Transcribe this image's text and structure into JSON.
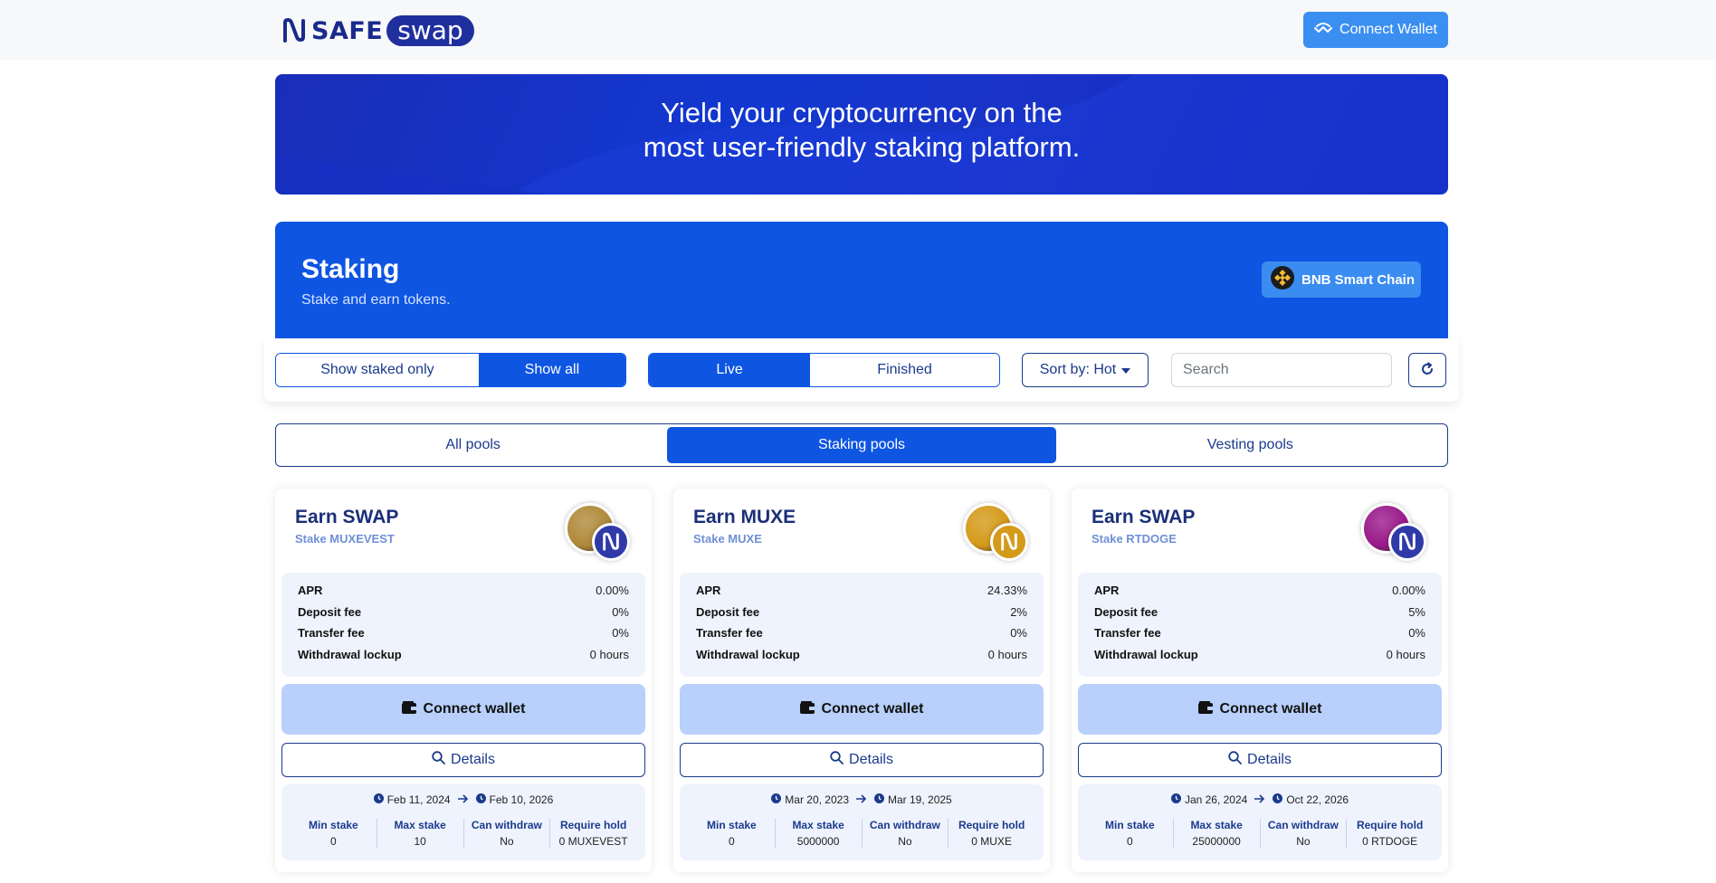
{
  "header": {
    "logo_safe": "SAFE",
    "logo_swap": "swap",
    "connect_label": "Connect Wallet"
  },
  "hero": {
    "line1": "Yield your cryptocurrency on the",
    "line2": "most user-friendly staking platform."
  },
  "staking": {
    "title": "Staking",
    "subtitle": "Stake and earn tokens.",
    "chain_label": "BNB Smart Chain"
  },
  "filters": {
    "staked_only": "Show staked only",
    "show_all": "Show all",
    "live": "Live",
    "finished": "Finished",
    "sort_label": "Sort by: Hot",
    "search_placeholder": "Search"
  },
  "pool_tabs": [
    "All pools",
    "Staking pools",
    "Vesting pools"
  ],
  "labels": {
    "apr": "APR",
    "deposit_fee": "Deposit fee",
    "transfer_fee": "Transfer fee",
    "withdrawal_lockup": "Withdrawal lockup",
    "connect_wallet": "Connect wallet",
    "details": "Details",
    "min_stake": "Min stake",
    "max_stake": "Max stake",
    "can_withdraw": "Can withdraw",
    "require_hold": "Require hold"
  },
  "cards": [
    {
      "title": "Earn SWAP",
      "subtitle": "Stake MUXEVEST",
      "apr": "0.00%",
      "deposit_fee": "0%",
      "transfer_fee": "0%",
      "withdrawal_lockup": "0 hours",
      "start": "Feb 11, 2024",
      "end": "Feb 10, 2026",
      "min_stake": "0",
      "max_stake": "10",
      "can_withdraw": "No",
      "require_hold": "0 MUXEVEST",
      "token_color": "#b08a3a",
      "reward_color": "#2f3aa8"
    },
    {
      "title": "Earn MUXE",
      "subtitle": "Stake MUXE",
      "apr": "24.33%",
      "deposit_fee": "2%",
      "transfer_fee": "0%",
      "withdrawal_lockup": "0 hours",
      "start": "Mar 20, 2023",
      "end": "Mar 19, 2025",
      "min_stake": "0",
      "max_stake": "5000000",
      "can_withdraw": "No",
      "require_hold": "0 MUXE",
      "token_color": "#d49a1a",
      "reward_color": "#d49a1a"
    },
    {
      "title": "Earn SWAP",
      "subtitle": "Stake RTDOGE",
      "apr": "0.00%",
      "deposit_fee": "5%",
      "transfer_fee": "0%",
      "withdrawal_lockup": "0 hours",
      "start": "Jan 26, 2024",
      "end": "Oct 22, 2026",
      "min_stake": "0",
      "max_stake": "25000000",
      "can_withdraw": "No",
      "require_hold": "0 RTDOGE",
      "token_color": "#9a1a8a",
      "reward_color": "#2f3aa8"
    }
  ]
}
